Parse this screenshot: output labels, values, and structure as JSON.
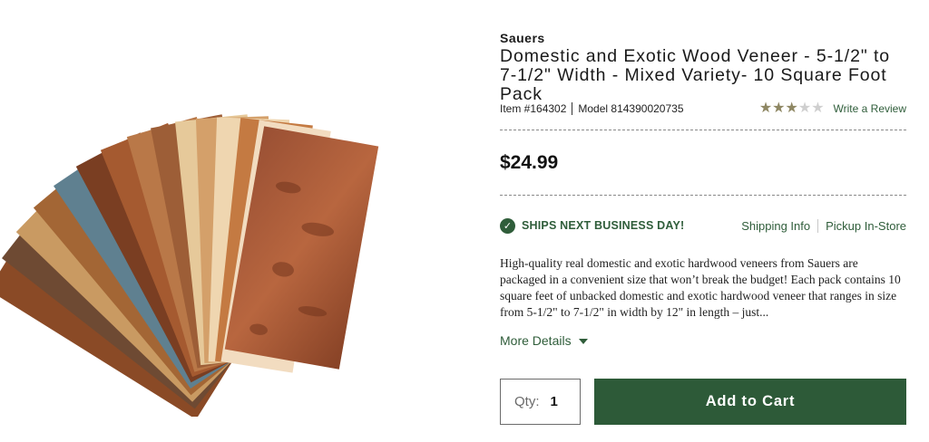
{
  "product": {
    "brand": "Sauers",
    "title": "Domestic and Exotic Wood Veneer - 5-1/2\" to 7-1/2\" Width - Mixed Variety- 10 Square Foot Pack",
    "item_number": "Item #164302",
    "model_number": "Model 814390020735",
    "rating": {
      "value": 3,
      "max": 5,
      "write_review_label": "Write a Review"
    },
    "price": "$24.99",
    "shipping": {
      "badge": "SHIPS NEXT BUSINESS DAY!",
      "shipping_info_label": "Shipping Info",
      "pickup_label": "Pickup In-Store"
    },
    "description": "High-quality real domestic and exotic hardwood veneers from Sauers are packaged in a convenient size that won’t break the budget! Each pack contains 10 square feet of unbacked domestic and exotic hardwood veneer that ranges in size from 5-1/2\" to 7-1/2\" in width by 12\" in length – just...",
    "more_details_label": "More Details",
    "quantity": {
      "label": "Qty:",
      "value": "1"
    },
    "add_to_cart_label": "Add to Cart"
  },
  "colors": {
    "brand_green": "#2d5a38",
    "star_on": "#8e8763",
    "star_off": "#cfcfcf"
  },
  "icons": {
    "check": "check-circle-icon",
    "caret": "caret-down-icon",
    "star": "star-icon"
  }
}
